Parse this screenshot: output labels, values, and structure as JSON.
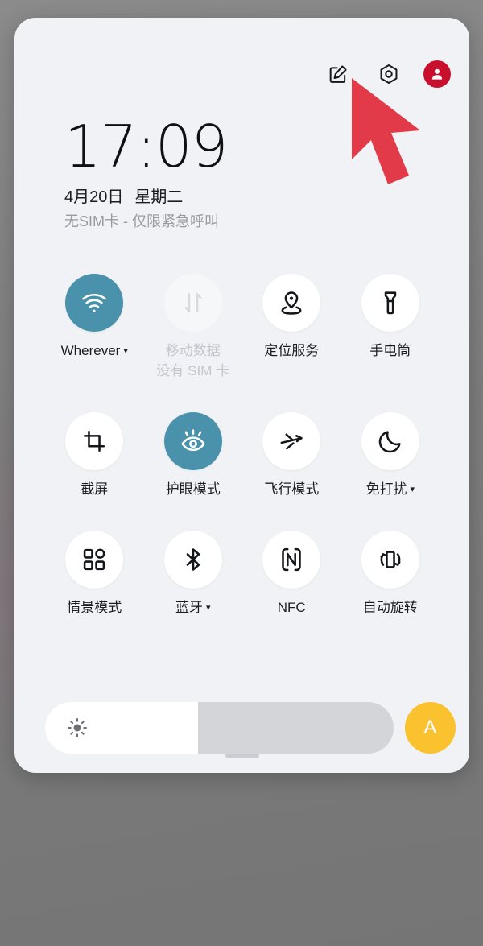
{
  "header": {
    "edit_icon": "edit-pencil-icon",
    "settings_icon": "settings-gear-icon",
    "avatar_icon": "user-avatar-icon",
    "avatar_color": "#c8102e"
  },
  "status": {
    "time": "17:09",
    "date": "4月20日",
    "weekday": "星期二",
    "sim_status": "无SIM卡 - 仅限紧急呼叫"
  },
  "tiles": [
    {
      "label": "Wherever",
      "sublabel": "",
      "icon": "wifi-icon",
      "state": "active",
      "caret": true
    },
    {
      "label": "移动数据",
      "sublabel": "没有 SIM 卡",
      "icon": "mobile-data-icon",
      "state": "disabled",
      "caret": false
    },
    {
      "label": "定位服务",
      "sublabel": "",
      "icon": "location-icon",
      "state": "inactive",
      "caret": false
    },
    {
      "label": "手电筒",
      "sublabel": "",
      "icon": "flashlight-icon",
      "state": "inactive",
      "caret": false
    },
    {
      "label": "截屏",
      "sublabel": "",
      "icon": "screenshot-icon",
      "state": "inactive",
      "caret": false
    },
    {
      "label": "护眼模式",
      "sublabel": "",
      "icon": "eye-care-icon",
      "state": "active",
      "caret": false
    },
    {
      "label": "飞行模式",
      "sublabel": "",
      "icon": "airplane-icon",
      "state": "inactive",
      "caret": false
    },
    {
      "label": "免打扰",
      "sublabel": "",
      "icon": "moon-icon",
      "state": "inactive",
      "caret": true
    },
    {
      "label": "情景模式",
      "sublabel": "",
      "icon": "scene-mode-icon",
      "state": "inactive",
      "caret": false
    },
    {
      "label": "蓝牙",
      "sublabel": "",
      "icon": "bluetooth-icon",
      "state": "inactive",
      "caret": true
    },
    {
      "label": "NFC",
      "sublabel": "",
      "icon": "nfc-icon",
      "state": "inactive",
      "caret": false
    },
    {
      "label": "自动旋转",
      "sublabel": "",
      "icon": "auto-rotate-icon",
      "state": "inactive",
      "caret": false
    }
  ],
  "brightness": {
    "icon": "brightness-sun-icon",
    "percent": 44,
    "auto_label": "A",
    "auto_color": "#f9c22e"
  },
  "theme": {
    "panel_bg": "#f0f2f5",
    "active_tile": "#4a92ab",
    "tile_bg": "#ffffff",
    "cursor_color": "#e23a48"
  }
}
